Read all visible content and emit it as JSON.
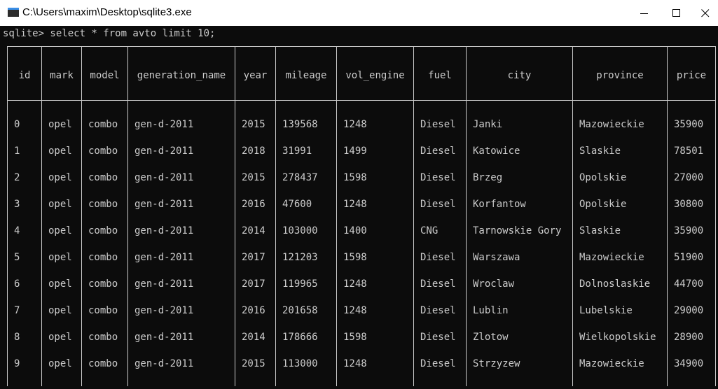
{
  "window": {
    "title": "C:\\Users\\maxim\\Desktop\\sqlite3.exe",
    "accent": "#3a8ee6",
    "controls": [
      "minimize-icon",
      "maximize-icon",
      "close-icon"
    ]
  },
  "console": {
    "background": "#0c0c0c",
    "foreground": "#cccccc",
    "prompt": "sqlite> select * from avto limit 10;"
  },
  "table": {
    "columns": [
      "id",
      "mark",
      "model",
      "generation_name",
      "year",
      "mileage",
      "vol_engine",
      "fuel",
      "city",
      "province",
      "price"
    ],
    "rows": [
      [
        "0",
        "opel",
        "combo",
        "gen-d-2011",
        "2015",
        "139568",
        "1248",
        "Diesel",
        "Janki",
        "Mazowieckie",
        "35900"
      ],
      [
        "1",
        "opel",
        "combo",
        "gen-d-2011",
        "2018",
        "31991",
        "1499",
        "Diesel",
        "Katowice",
        "Slaskie",
        "78501"
      ],
      [
        "2",
        "opel",
        "combo",
        "gen-d-2011",
        "2015",
        "278437",
        "1598",
        "Diesel",
        "Brzeg",
        "Opolskie",
        "27000"
      ],
      [
        "3",
        "opel",
        "combo",
        "gen-d-2011",
        "2016",
        "47600",
        "1248",
        "Diesel",
        "Korfantow",
        "Opolskie",
        "30800"
      ],
      [
        "4",
        "opel",
        "combo",
        "gen-d-2011",
        "2014",
        "103000",
        "1400",
        "CNG",
        "Tarnowskie Gory",
        "Slaskie",
        "35900"
      ],
      [
        "5",
        "opel",
        "combo",
        "gen-d-2011",
        "2017",
        "121203",
        "1598",
        "Diesel",
        "Warszawa",
        "Mazowieckie",
        "51900"
      ],
      [
        "6",
        "opel",
        "combo",
        "gen-d-2011",
        "2017",
        "119965",
        "1248",
        "Diesel",
        "Wroclaw",
        "Dolnoslaskie",
        "44700"
      ],
      [
        "7",
        "opel",
        "combo",
        "gen-d-2011",
        "2016",
        "201658",
        "1248",
        "Diesel",
        "Lublin",
        "Lubelskie",
        "29000"
      ],
      [
        "8",
        "opel",
        "combo",
        "gen-d-2011",
        "2014",
        "178666",
        "1598",
        "Diesel",
        "Zlotow",
        "Wielkopolskie",
        "28900"
      ],
      [
        "9",
        "opel",
        "combo",
        "gen-d-2011",
        "2015",
        "113000",
        "1248",
        "Diesel",
        "Strzyzew",
        "Mazowieckie",
        "34900"
      ]
    ]
  }
}
